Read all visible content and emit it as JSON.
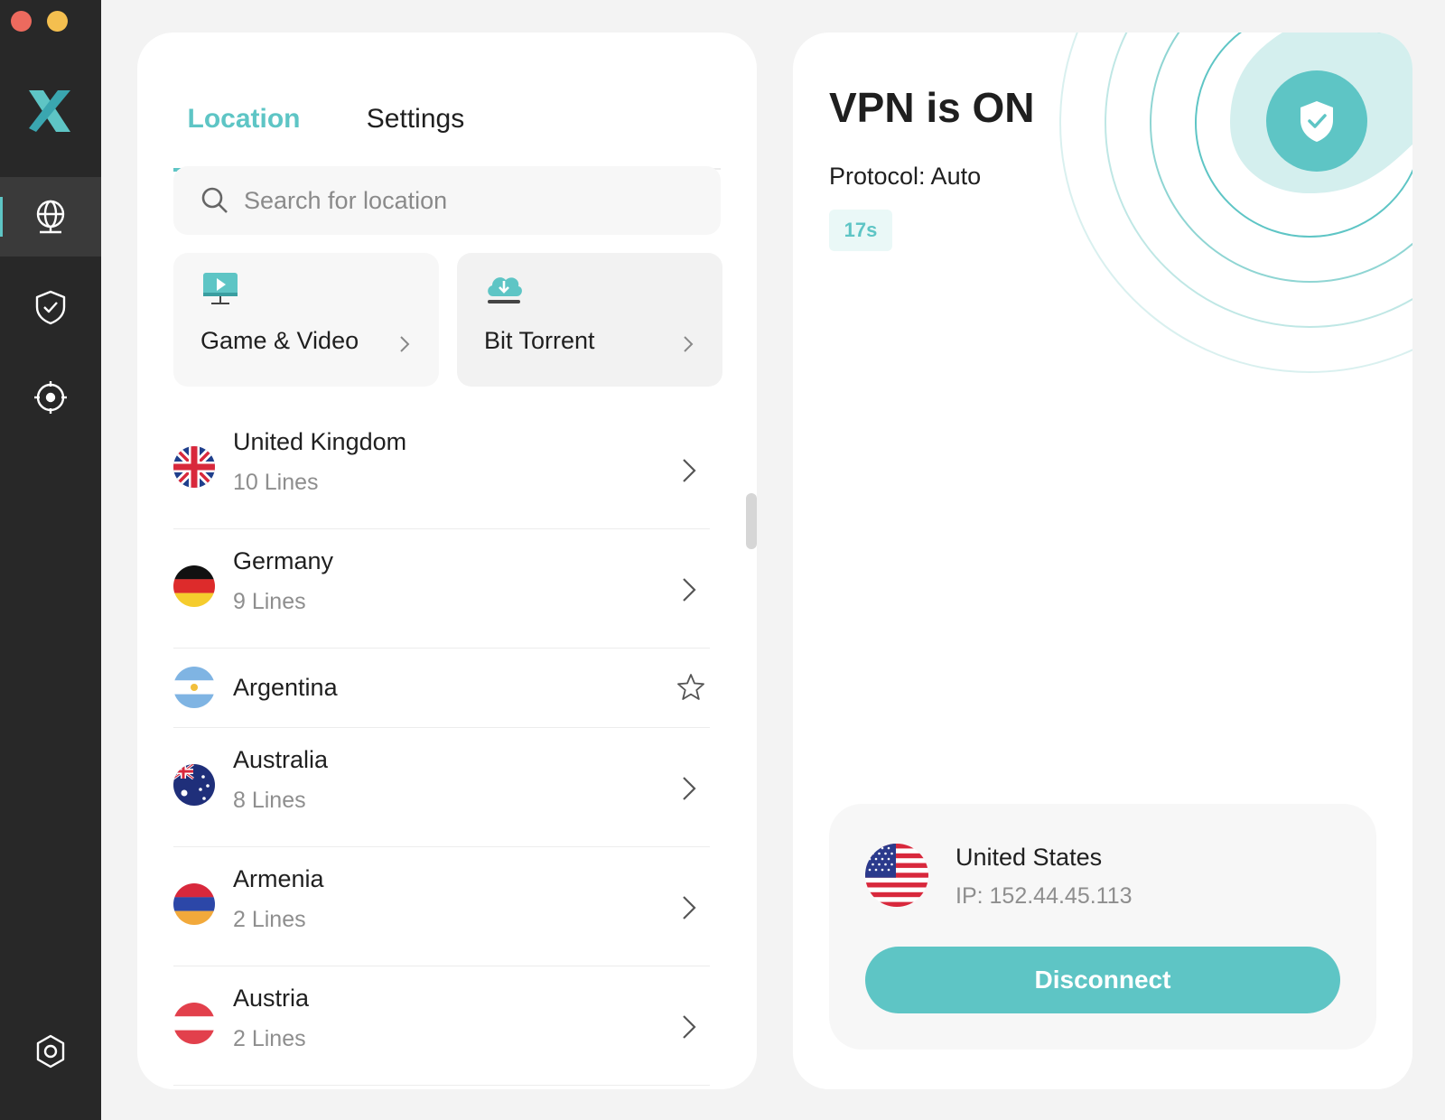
{
  "theme": {
    "accent": "#5ec5c5",
    "sidebar_bg": "#282828",
    "panel_bg": "#ffffff",
    "window_bg": "#f3f3f3"
  },
  "sidebar": {
    "items": [
      {
        "name": "globe-icon",
        "active": true
      },
      {
        "name": "shield-check-icon",
        "active": false
      },
      {
        "name": "crosshair-icon",
        "active": false
      },
      {
        "name": "settings-gear-icon",
        "active": false
      }
    ]
  },
  "tabs": [
    {
      "label": "Location",
      "active": true
    },
    {
      "label": "Settings",
      "active": false
    }
  ],
  "search": {
    "placeholder": "Search for location",
    "value": ""
  },
  "categories": [
    {
      "label": "Game & Video",
      "icon": "monitor-play-icon"
    },
    {
      "label": "Bit Torrent",
      "icon": "cloud-download-icon"
    }
  ],
  "locations": [
    {
      "name": "United Kingdom",
      "lines": "10 Lines",
      "flag": "uk"
    },
    {
      "name": "Germany",
      "lines": "9 Lines",
      "flag": "de"
    },
    {
      "name": "Argentina",
      "lines": "",
      "flag": "ar",
      "action": "star"
    },
    {
      "name": "Australia",
      "lines": "8 Lines",
      "flag": "au"
    },
    {
      "name": "Armenia",
      "lines": "2 Lines",
      "flag": "am"
    },
    {
      "name": "Austria",
      "lines": "2 Lines",
      "flag": "at"
    }
  ],
  "status": {
    "title": "VPN is ON",
    "protocol": "Protocol: Auto",
    "timer": "17s"
  },
  "connection": {
    "country": "United States",
    "ip": "IP: 152.44.45.113",
    "button_label": "Disconnect"
  }
}
